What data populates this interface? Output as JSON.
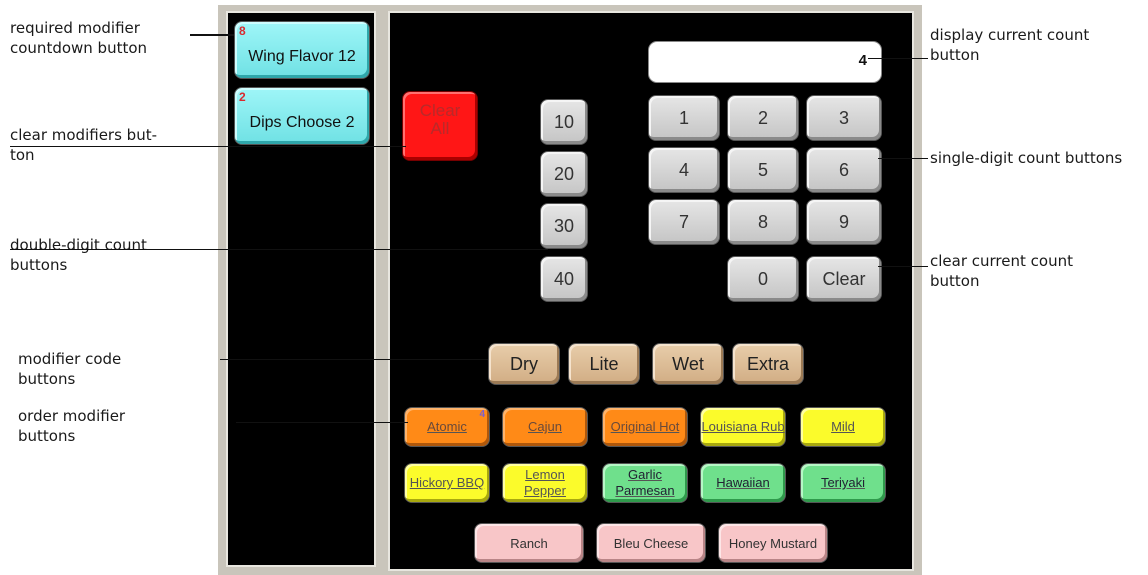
{
  "annotations": {
    "required_modifier": "required modifier\ncountdown button",
    "clear_modifiers": "clear modifiers but-\nton",
    "double_digit": "double-digit count\nbuttons",
    "modifier_code": "modifier code\nbuttons",
    "order_modifier": "order modifier\nbuttons",
    "display_count": "display current count\nbutton",
    "single_digit": "single-digit count buttons",
    "clear_count": "clear current count\nbutton"
  },
  "left_panel": {
    "required": [
      {
        "count": "8",
        "label": "Wing Flavor 12"
      },
      {
        "count": "2",
        "label": "Dips Choose 2"
      }
    ]
  },
  "clear_all": {
    "line1": "Clear",
    "line2": "All"
  },
  "display": {
    "value": "4"
  },
  "tens": [
    "10",
    "20",
    "30",
    "40"
  ],
  "digits": [
    "1",
    "2",
    "3",
    "4",
    "5",
    "6",
    "7",
    "8",
    "9"
  ],
  "zero": "0",
  "clear": "Clear",
  "codes": [
    "Dry",
    "Lite",
    "Wet",
    "Extra"
  ],
  "modifiers": {
    "row1": [
      {
        "label": "Atomic",
        "count": "4",
        "color": "#ff8a17"
      },
      {
        "label": "Cajun",
        "count": "",
        "color": "#ff8a17"
      },
      {
        "label": "Original Hot",
        "count": "",
        "color": "#ff8a17"
      },
      {
        "label": "Louisiana Rub",
        "count": "",
        "color": "#fbfb2b"
      },
      {
        "label": "Mild",
        "count": "",
        "color": "#fbfb2b"
      }
    ],
    "row2": [
      {
        "label": "Hickory BBQ",
        "color": "#fbfb2b"
      },
      {
        "label": "Lemon Pepper",
        "color": "#fbfb2b"
      },
      {
        "label": "Garlic Parmesan",
        "color": "#6fe08c"
      },
      {
        "label": "Hawaiian",
        "color": "#6fe08c"
      },
      {
        "label": "Teriyaki",
        "color": "#6fe08c"
      }
    ],
    "row3": [
      {
        "label": "Ranch",
        "color": "#f8c6c8"
      },
      {
        "label": "Bleu Cheese",
        "color": "#f8c6c8"
      },
      {
        "label": "Honey Mustard",
        "color": "#f8c6c8"
      }
    ]
  }
}
